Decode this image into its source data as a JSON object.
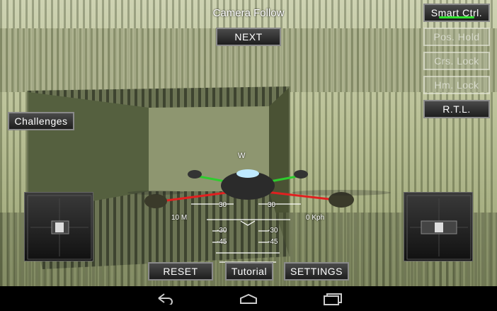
{
  "hud": {
    "camera_mode": "Camera Follow",
    "altitude": "10 M",
    "speed": "0 Kph",
    "compass": "W",
    "pitch_ladder": [
      "30",
      "30",
      "-30",
      "-30",
      "-45",
      "-45"
    ]
  },
  "buttons": {
    "next": "NEXT",
    "smart_ctrl": "Smart Ctrl.",
    "pos_hold": "Pos. Hold",
    "crs_lock": "Crs. Lock",
    "hm_lock": "Hm. Lock",
    "rtl": "R.T.L.",
    "challenges": "Challenges",
    "reset": "RESET",
    "tutorial": "Tutorial",
    "settings": "SETTINGS"
  },
  "status": {
    "smart_ctrl_active": true
  },
  "icons": {
    "back": "back-arrow-icon",
    "home": "home-icon",
    "recents": "recent-apps-icon"
  },
  "colors": {
    "active_indicator": "#2ee02e",
    "arm_left": "#2ecc2e",
    "arm_right": "#e02020"
  }
}
